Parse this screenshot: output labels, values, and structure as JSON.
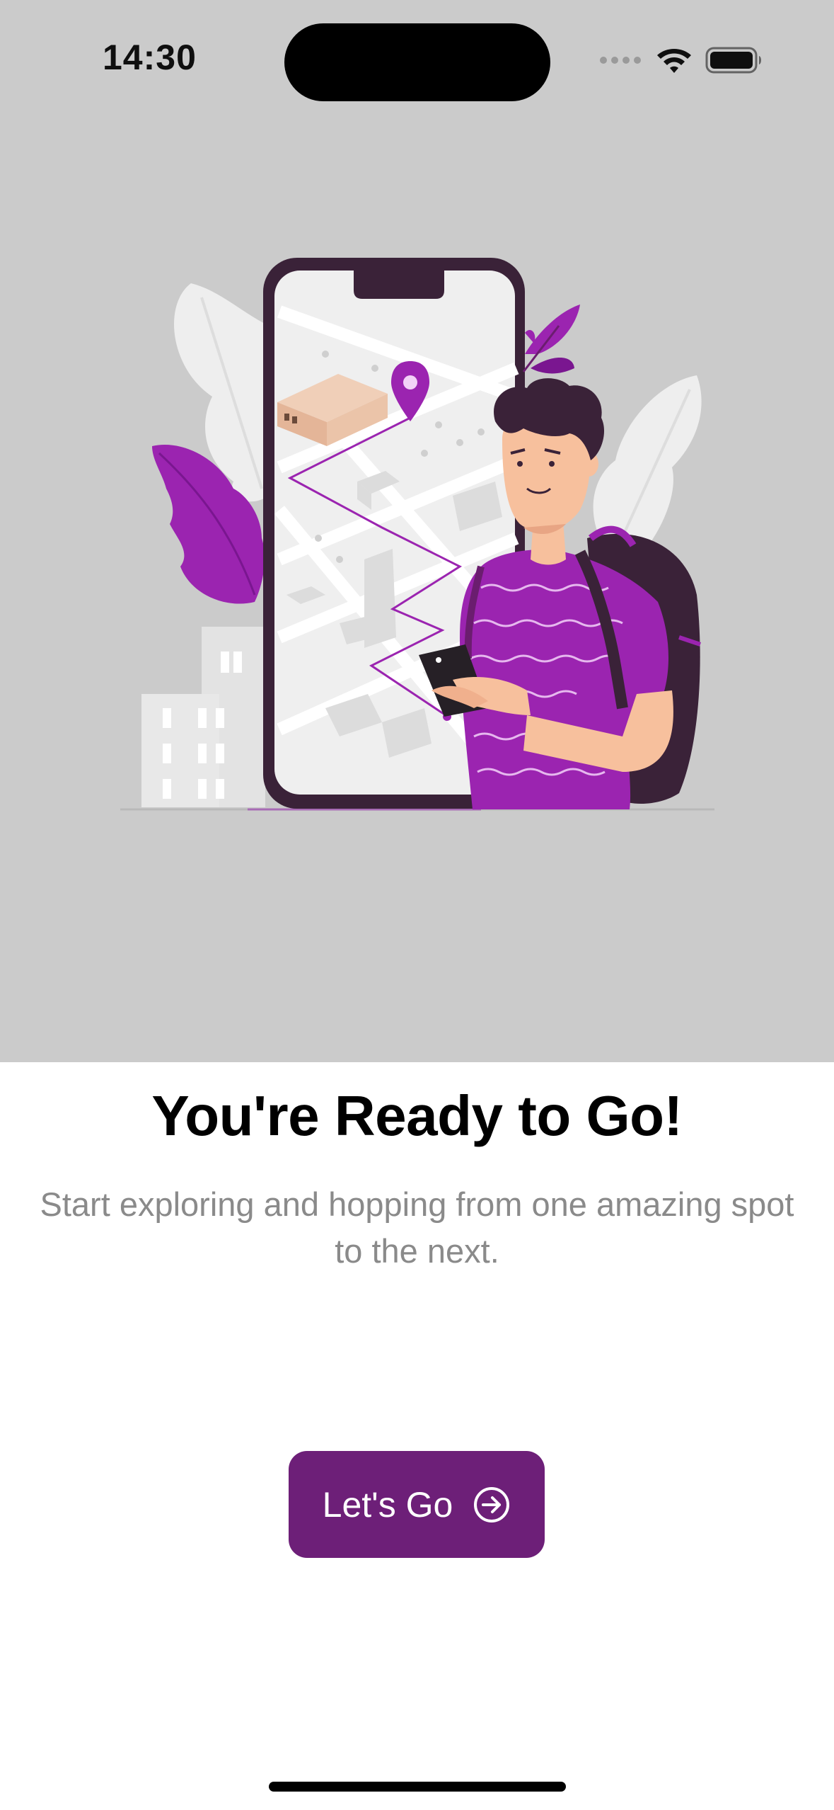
{
  "status_bar": {
    "time": "14:30",
    "signal_icon": "cellular-dots-icon",
    "wifi_icon": "wifi-icon",
    "battery_icon": "battery-icon"
  },
  "illustration": {
    "description_icon": "traveler-with-map-phone-illustration",
    "accent_color": "#9b24b0",
    "background_color": "#cbcbcb"
  },
  "onboarding": {
    "title": "You're Ready to Go!",
    "subtitle": "Start exploring and hopping from one amazing spot to the next."
  },
  "cta": {
    "label": "Let's Go",
    "icon": "arrow-right-circle-icon",
    "color": "#6d1f78"
  }
}
